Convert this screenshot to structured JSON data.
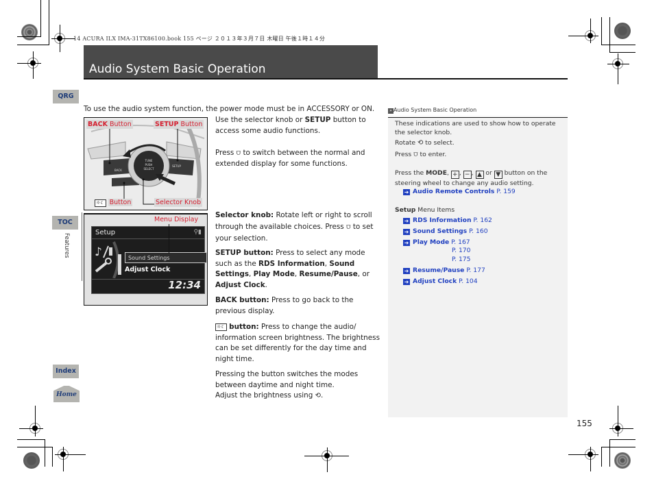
{
  "print_header": "14 ACURA ILX IMA-31TX86100.book  155 ページ  ２０１３年３月７日  木曜日  午後１時１４分",
  "title": "Audio System Basic Operation",
  "side_tabs": {
    "qrg": "QRG",
    "toc": "TOC",
    "section": "Features",
    "index": "Index",
    "home": "Home"
  },
  "intro": "To use the audio system function, the power mode must be in ACCESSORY or ON.",
  "figure1": {
    "callouts": {
      "back_bold": "BACK",
      "back_rest": " Button",
      "setup_bold": "SETUP",
      "setup_rest": " Button",
      "brightness_rest": "Button",
      "selector": "Selector Knob"
    },
    "knob_label": "TUNE PUSH SELECT",
    "back_btn_label": "BACK",
    "setup_btn_label": "SETUP"
  },
  "figure2": {
    "callout": "Menu Display",
    "lcd_title": "Setup",
    "menu_selected": "Sound Settings",
    "menu_next": "Adjust Clock",
    "clock": "12:34"
  },
  "main": {
    "p1_a": "Use the selector knob or ",
    "p1_b": "SETUP",
    "p1_c": " button to access some audio functions.",
    "p2_a": "Press ",
    "p2_c": " to switch between the normal and extended display for some functions.",
    "selector_title": "Selector knob:",
    "selector_a": " Rotate left or right to scroll through the available choices. Press ",
    "selector_b": " to set your selection.",
    "setup_title": "SETUP button:",
    "setup_a": " Press to select any mode such as the ",
    "setup_items": [
      "RDS Information",
      "Sound Settings",
      "Play Mode",
      "Resume/Pause",
      "Adjust Clock"
    ],
    "back_title": "BACK button:",
    "back_text": " Press to go back to the previous display.",
    "bright_title": " button:",
    "bright_text": " Press to change the audio/ information screen brightness. The brightness can be set differently for the day time and night time.",
    "modes_a": "Pressing the button switches the modes between daytime and night time.",
    "modes_b": "Adjust the brightness using ",
    "modes_c": "."
  },
  "sidebar": {
    "header": "Audio System Basic Operation",
    "n1": "These indications are used to show how to operate the selector knob.",
    "n2_a": "Rotate ",
    "n2_b": " to select.",
    "n3_a": "Press ",
    "n3_b": " to enter.",
    "n4_a": "Press the ",
    "n4_mode": "MODE",
    "n4_b": " button on the steering wheel to change any audio setting.",
    "n4_or": "or",
    "remote_link": "Audio Remote Controls",
    "remote_page": "P. 159",
    "setup_bold": "Setup",
    "setup_rest": " Menu Items",
    "links": [
      {
        "label": "RDS Information",
        "pages": [
          "P. 162"
        ]
      },
      {
        "label": "Sound Settings",
        "pages": [
          "P. 160"
        ]
      },
      {
        "label": "Play Mode",
        "pages": [
          "P. 167",
          "P. 170",
          "P. 175"
        ]
      },
      {
        "label": "Resume/Pause",
        "pages": [
          "P. 177"
        ]
      },
      {
        "label": "Adjust Clock",
        "pages": [
          "P. 104"
        ]
      }
    ]
  },
  "page_number": "155",
  "colors": {
    "title_bar": "#4a4a4a",
    "tab_bg": "#b4b4b0",
    "tab_text": "#1d3b78",
    "callout_red": "#d42030",
    "link_blue": "#2040c0",
    "sidebar_bg": "#f2f2f2"
  }
}
